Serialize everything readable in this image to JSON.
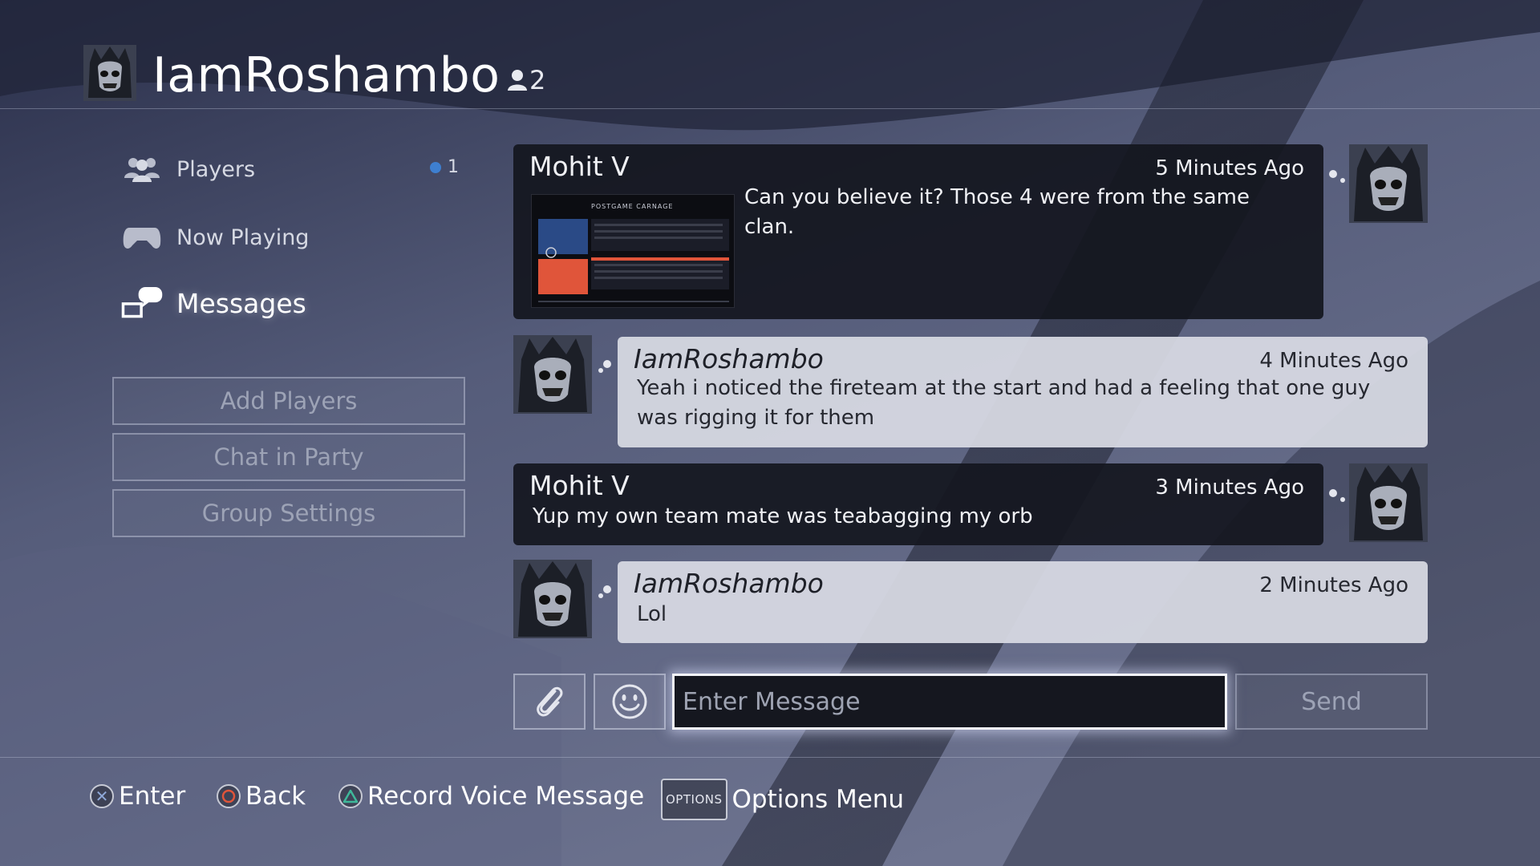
{
  "header": {
    "title": "IamRoshambo",
    "member_count": "2"
  },
  "sidebar": {
    "items": [
      {
        "label": "Players",
        "icon": "players-icon",
        "badge": "1"
      },
      {
        "label": "Now Playing",
        "icon": "controller-icon"
      },
      {
        "label": "Messages",
        "icon": "messages-icon",
        "active": true
      }
    ],
    "buttons": [
      {
        "label": "Add Players"
      },
      {
        "label": "Chat in Party"
      },
      {
        "label": "Group Settings"
      }
    ]
  },
  "messages": [
    {
      "sender": "Mohit V",
      "time": "5 Minutes Ago",
      "text": "Can you believe it? Those 4 were from the same clan.",
      "style": "dark",
      "has_image": true,
      "image_caption": "POSTGAME CARNAGE"
    },
    {
      "sender": "IamRoshambo",
      "time": "4 Minutes Ago",
      "text": "Yeah i noticed the fireteam at the start and had a feeling that one guy was rigging it for them",
      "style": "light"
    },
    {
      "sender": "Mohit V",
      "time": "3 Minutes Ago",
      "text": "Yup my own team mate was teabagging my orb",
      "style": "dark"
    },
    {
      "sender": "IamRoshambo",
      "time": "2 Minutes Ago",
      "text": "Lol",
      "style": "light"
    }
  ],
  "composer": {
    "placeholder": "Enter Message",
    "send_label": "Send",
    "attach_icon": "paperclip-icon",
    "emoji_icon": "smiley-icon"
  },
  "footer": {
    "hints": [
      {
        "button": "cross",
        "label": "Enter"
      },
      {
        "button": "circle",
        "label": "Back"
      },
      {
        "button": "triangle",
        "label": "Record Voice Message"
      },
      {
        "button": "options",
        "key_label": "OPTIONS",
        "label": "Options Menu"
      }
    ]
  },
  "colors": {
    "accent_blue": "#3e7fd0",
    "circle_red": "#e0553a",
    "triangle_green": "#3fb89a",
    "cross_blue": "#8fa8d8"
  }
}
